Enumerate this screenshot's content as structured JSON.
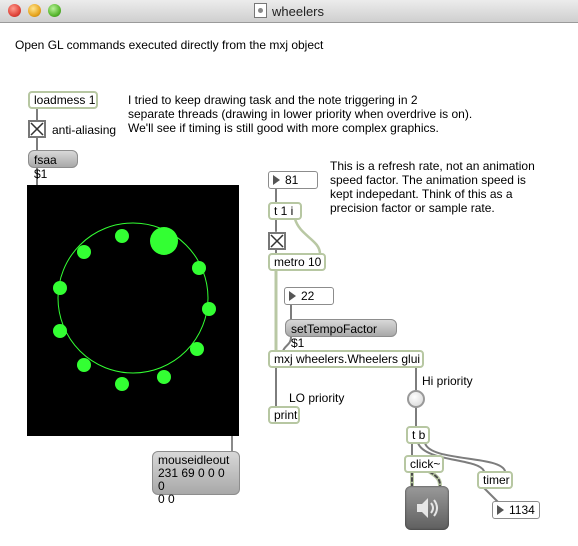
{
  "window": {
    "title": "wheelers"
  },
  "comments": {
    "header": "Open GL commands executed directly from the mxj object",
    "threads": "I tried to keep drawing task and the note triggering in 2\nseparate threads (drawing in lower priority when overdrive is on).\nWe'll see if timing is still good with more complex graphics.",
    "refresh": "This is a refresh rate, not an animation\nspeed factor. The animation speed is\nkept indepedant. Think of this as a\nprecision factor or sample rate.",
    "anti_aliasing": "anti-aliasing",
    "lo_priority": "LO priority",
    "hi_priority": "Hi priority"
  },
  "objects": {
    "loadmess": "loadmess 1",
    "t1i": "t 1 i",
    "metro": "metro 10",
    "mxj": "mxj wheelers.Wheelers glui",
    "print": "print",
    "tb": "t b",
    "click": "click~",
    "timer": "timer"
  },
  "messages": {
    "fsaa": "fsaa $1",
    "set_tempo": "setTempoFactor $1",
    "mouse_line1": "mouseidleout",
    "mouse_line2": "231 69 0 0 0 0",
    "mouse_line3": "0 0"
  },
  "numbers": {
    "refresh_rate": "81",
    "tempo_factor": "22",
    "timer_out": "1134"
  },
  "colors": {
    "wheel": "#33ff33",
    "display_bg": "#000000",
    "object_border": "#b7c7a2"
  },
  "icons": {
    "toggle": "x-checkbox-icon",
    "bang": "bang-circle-icon",
    "speaker": "speaker-icon"
  }
}
